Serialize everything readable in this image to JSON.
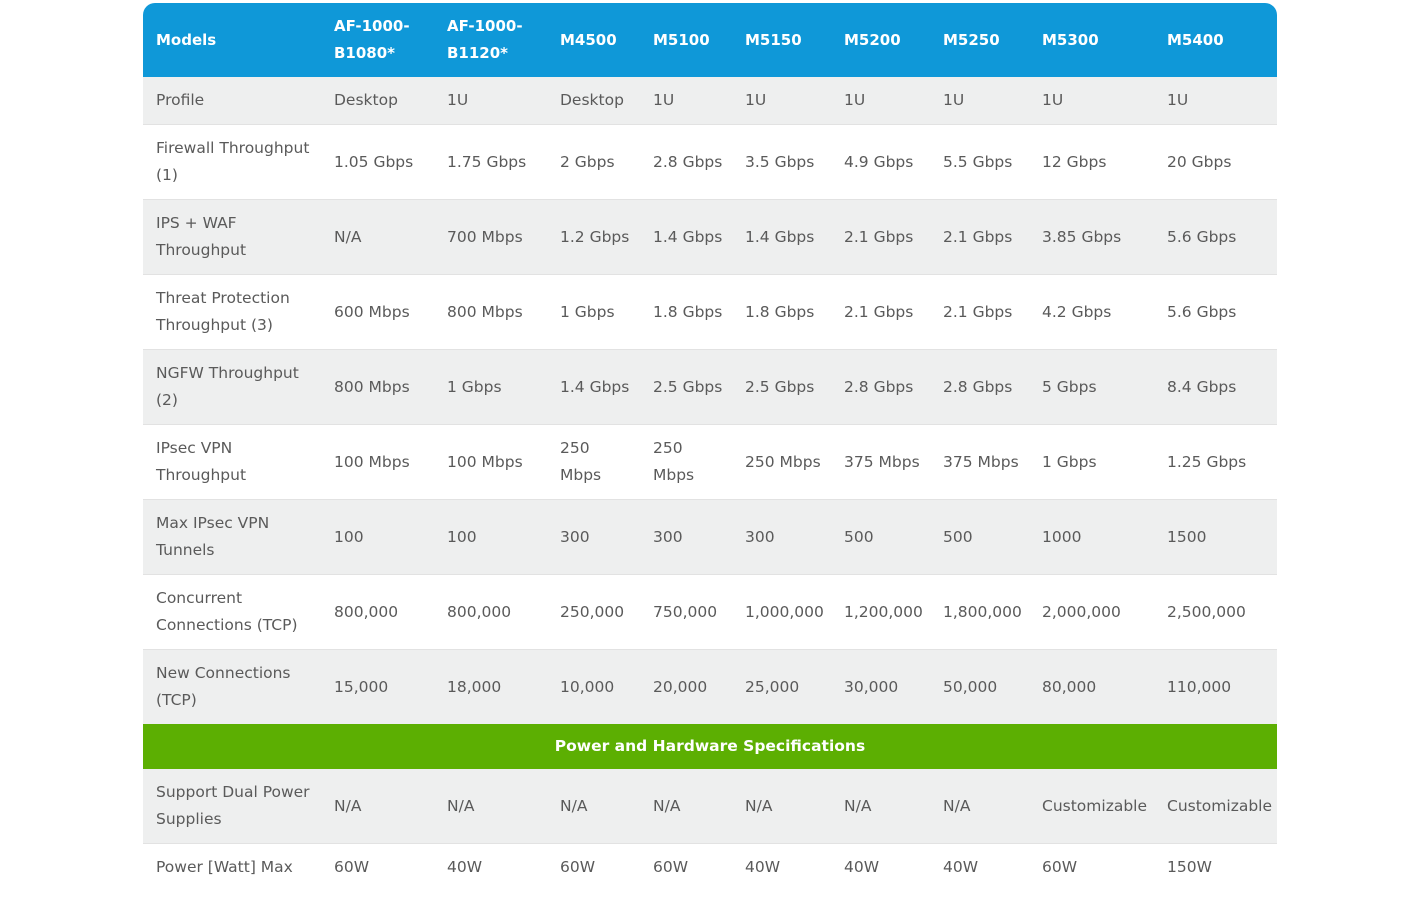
{
  "header": {
    "models_label": "Models",
    "models": [
      "AF-1000-B1080*",
      "AF-1000-B1120*",
      "M4500",
      "M5100",
      "M5150",
      "M5200",
      "M5250",
      "M5300",
      "M5400"
    ]
  },
  "performance_rows": [
    {
      "label": "Profile",
      "values": [
        "Desktop",
        "1U",
        "Desktop",
        "1U",
        "1U",
        "1U",
        "1U",
        "1U",
        "1U"
      ]
    },
    {
      "label": "Firewall Throughput (1)",
      "values": [
        "1.05 Gbps",
        "1.75 Gbps",
        "2 Gbps",
        "2.8 Gbps",
        "3.5 Gbps",
        "4.9 Gbps",
        "5.5 Gbps",
        "12 Gbps",
        "20 Gbps"
      ]
    },
    {
      "label": "IPS + WAF Throughput",
      "values": [
        "N/A",
        "700 Mbps",
        "1.2 Gbps",
        "1.4 Gbps",
        "1.4 Gbps",
        "2.1 Gbps",
        "2.1 Gbps",
        "3.85 Gbps",
        "5.6 Gbps"
      ]
    },
    {
      "label": "Threat Protection Throughput (3)",
      "values": [
        "600 Mbps",
        "800 Mbps",
        "1 Gbps",
        "1.8 Gbps",
        "1.8 Gbps",
        "2.1 Gbps",
        "2.1 Gbps",
        "4.2 Gbps",
        "5.6 Gbps"
      ]
    },
    {
      "label": "NGFW Throughput (2)",
      "values": [
        "800 Mbps",
        "1 Gbps",
        "1.4 Gbps",
        "2.5 Gbps",
        "2.5 Gbps",
        "2.8 Gbps",
        "2.8 Gbps",
        "5 Gbps",
        "8.4 Gbps"
      ]
    },
    {
      "label": "IPsec VPN Throughput",
      "values": [
        "100 Mbps",
        "100 Mbps",
        "250 Mbps",
        "250 Mbps",
        "250 Mbps",
        "375 Mbps",
        "375 Mbps",
        "1 Gbps",
        "1.25 Gbps"
      ]
    },
    {
      "label": "Max IPsec VPN Tunnels",
      "values": [
        "100",
        "100",
        "300",
        "300",
        "300",
        "500",
        "500",
        "1000",
        "1500"
      ]
    },
    {
      "label": "Concurrent Connections (TCP)",
      "values": [
        "800,000",
        "800,000",
        "250,000",
        "750,000",
        "1,000,000",
        "1,200,000",
        "1,800,000",
        "2,000,000",
        "2,500,000"
      ]
    },
    {
      "label": "New Connections (TCP)",
      "values": [
        "15,000",
        "18,000",
        "10,000",
        "20,000",
        "25,000",
        "30,000",
        "50,000",
        "80,000",
        "110,000"
      ]
    }
  ],
  "section_title": "Power and Hardware Specifications",
  "hardware_rows": [
    {
      "label": "Support Dual Power Supplies",
      "values": [
        "N/A",
        "N/A",
        "N/A",
        "N/A",
        "N/A",
        "N/A",
        "N/A",
        "Customizable",
        "Customizable"
      ]
    },
    {
      "label": "Power [Watt] Max",
      "values": [
        "60W",
        "40W",
        "60W",
        "60W",
        "40W",
        "40W",
        "40W",
        "60W",
        "150W"
      ]
    }
  ],
  "colors": {
    "header_bg": "#0f98d8",
    "section_bg": "#5caf02",
    "row_alt_bg": "#eeefef",
    "text": "#5a5a5a"
  }
}
